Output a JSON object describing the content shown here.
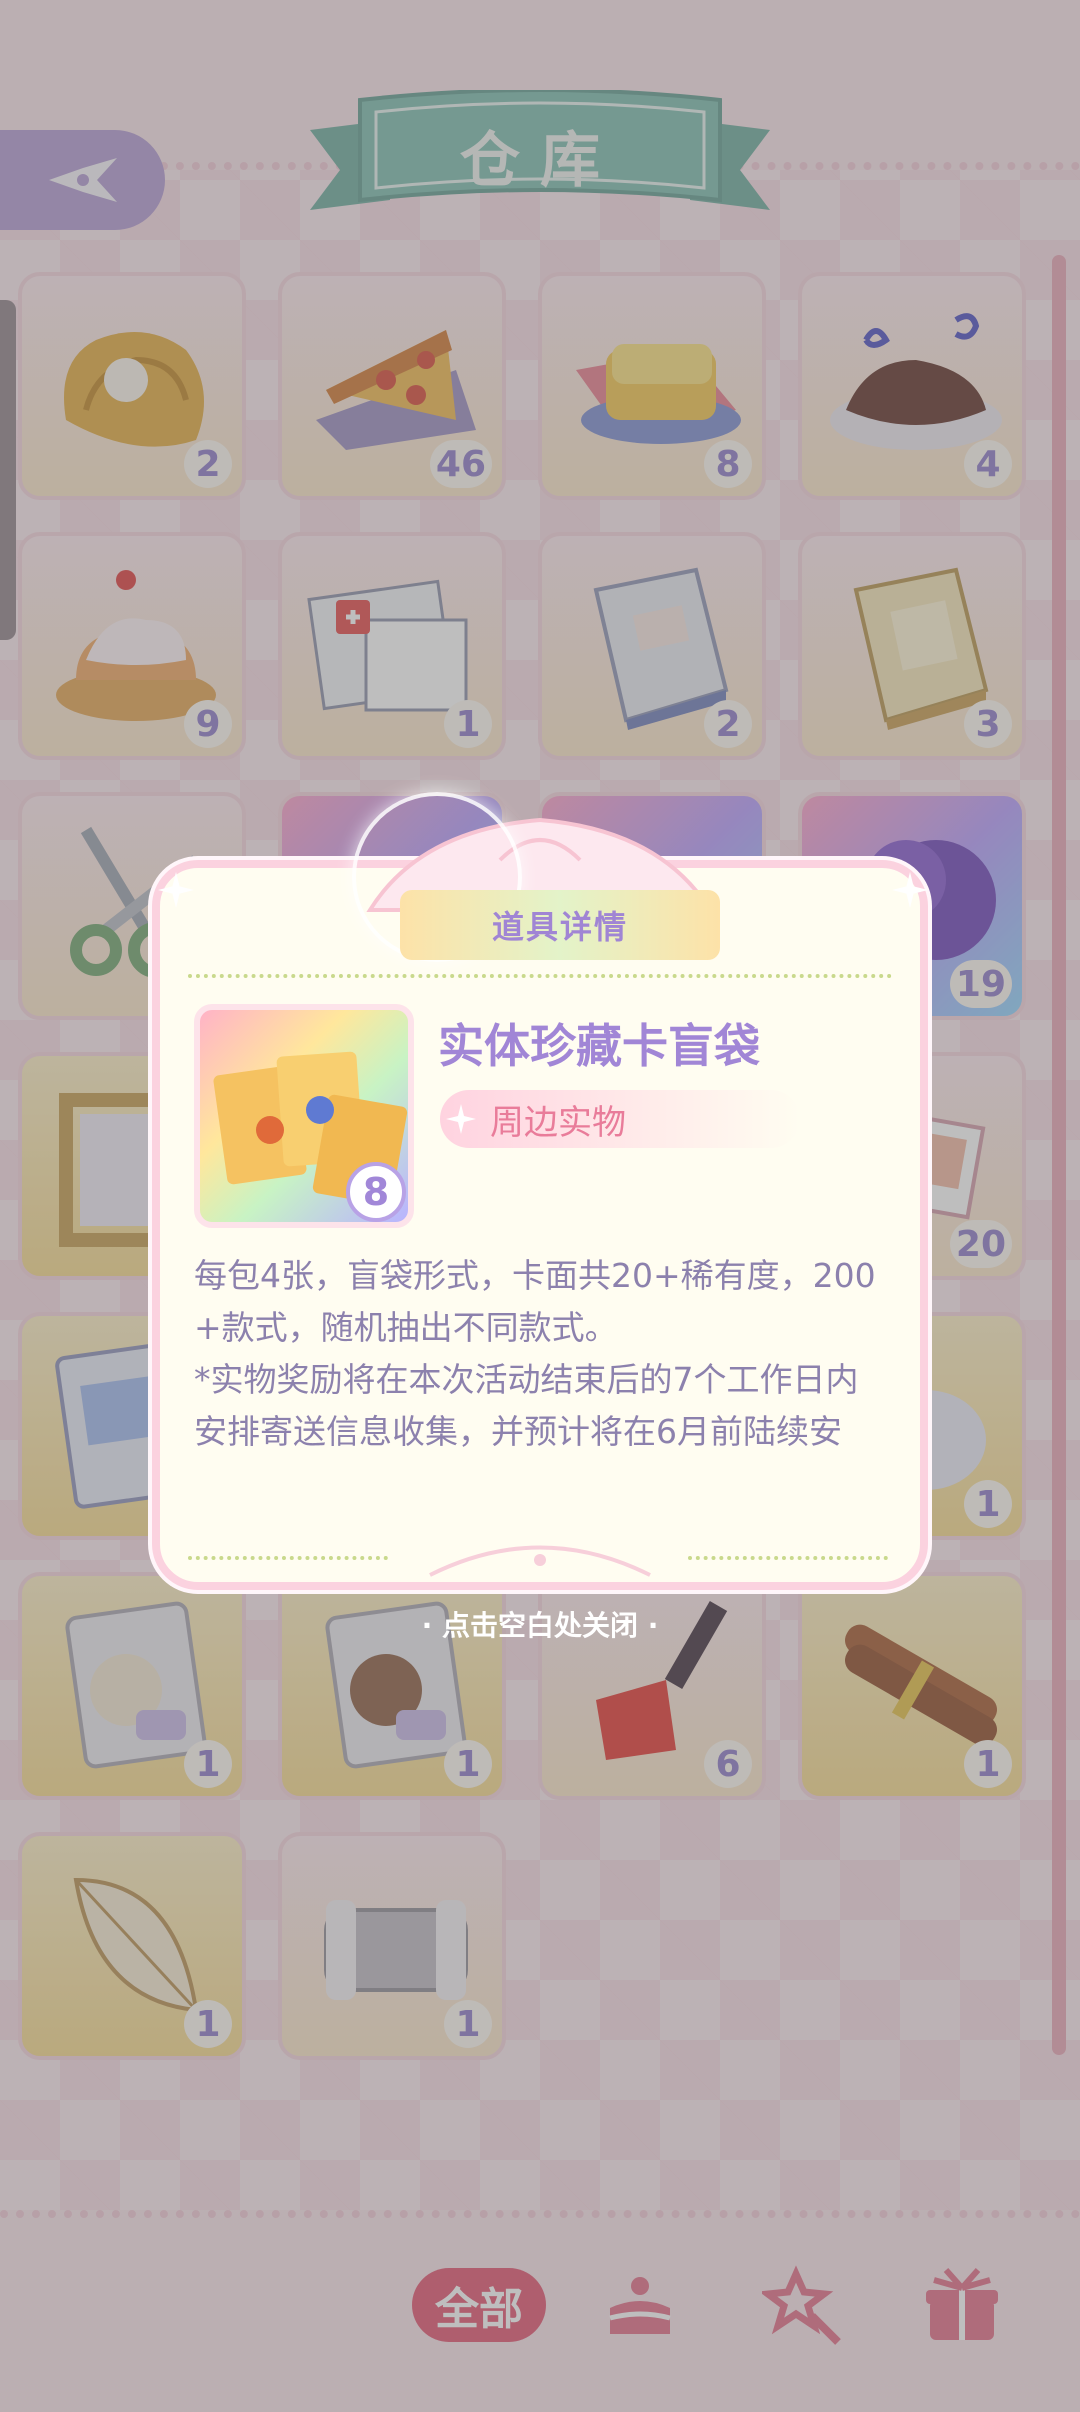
{
  "header": {
    "title": "仓库"
  },
  "inventory": {
    "items": [
      {
        "name": "bread-loaf",
        "count": "2"
      },
      {
        "name": "pizza-slice",
        "count": "46"
      },
      {
        "name": "toast",
        "count": "8"
      },
      {
        "name": "chocolate-cake",
        "count": "4"
      },
      {
        "name": "cream-puff",
        "count": "9"
      },
      {
        "name": "medical-newspaper",
        "count": "1"
      },
      {
        "name": "acting-book",
        "count": "2"
      },
      {
        "name": "handcraft-book",
        "count": "3"
      },
      {
        "name": "scissors",
        "count": ""
      },
      {
        "name": "purple-item-a",
        "count": ""
      },
      {
        "name": "purple-item-b",
        "count": ""
      },
      {
        "name": "purple-tree-card",
        "count": "19"
      },
      {
        "name": "gold-frame",
        "count": ""
      },
      {
        "name": "photo-card",
        "count": "20"
      },
      {
        "name": "sticker-pack",
        "count": ""
      },
      {
        "name": "plush-toy",
        "count": "1"
      },
      {
        "name": "vanilla-cookie-bag",
        "count": "1"
      },
      {
        "name": "chocolate-cookie-bag",
        "count": "1"
      },
      {
        "name": "red-shovel",
        "count": "6"
      },
      {
        "name": "cinnamon-sticks",
        "count": "1"
      },
      {
        "name": "leaf",
        "count": "1"
      },
      {
        "name": "grey-scarf",
        "count": "1"
      }
    ]
  },
  "dialog": {
    "title": "道具详情",
    "item_name": "实体珍藏卡盲袋",
    "item_tag": "周边实物",
    "item_count": "8",
    "description_lines": [
      "每包4张，盲袋形式，卡面共20+稀有度，200",
      "+款式，随机抽出不同款式。",
      "*实物奖励将在本次活动结束后的7个工作日内",
      "安排寄送信息收集，并预计将在6月前陆续安"
    ],
    "close_hint": "· 点击空白处关闭 ·"
  },
  "bottom_bar": {
    "categories": [
      {
        "label": "全部",
        "icon": "all"
      },
      {
        "label": "",
        "icon": "cake-icon"
      },
      {
        "label": "",
        "icon": "wand-icon"
      },
      {
        "label": "",
        "icon": "gift-box-icon"
      }
    ]
  },
  "colors": {
    "accent_purple": "#a186d6",
    "tag_pink": "#e97c9a",
    "active_tab": "#e4506e",
    "ribbon_green": "#7bbcae"
  }
}
